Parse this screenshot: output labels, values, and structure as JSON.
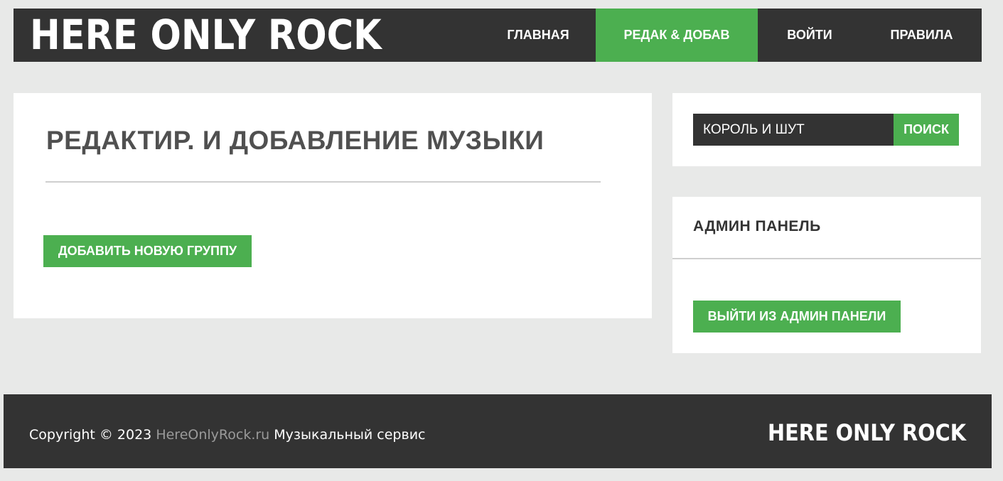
{
  "header": {
    "logo": "HERE ONLY ROCK",
    "nav": {
      "home": "ГЛАВНАЯ",
      "edit": "РЕДАК & ДОБАВ",
      "login": "ВОЙТИ",
      "rules": "ПРАВИЛА"
    }
  },
  "main": {
    "title": "РЕДАКТИР. И ДОБАВЛЕНИЕ МУЗЫКИ",
    "add_group_label": "ДОБАВИТЬ НОВУЮ ГРУППУ"
  },
  "search": {
    "value": "КОРОЛЬ И ШУТ",
    "button_label": "ПОИСК"
  },
  "admin": {
    "title": "АДМИН ПАНЕЛЬ",
    "logout_label": "ВЫЙТИ ИЗ АДМИН ПАНЕЛИ"
  },
  "footer": {
    "copyright_prefix": "Copyright © 2023",
    "site": "HereOnlyRock.ru",
    "service": "Музыкальный сервис",
    "logo": "HERE ONLY ROCK"
  },
  "colors": {
    "accent": "#4caf50",
    "dark": "#333333",
    "background": "#e8e9e8"
  }
}
